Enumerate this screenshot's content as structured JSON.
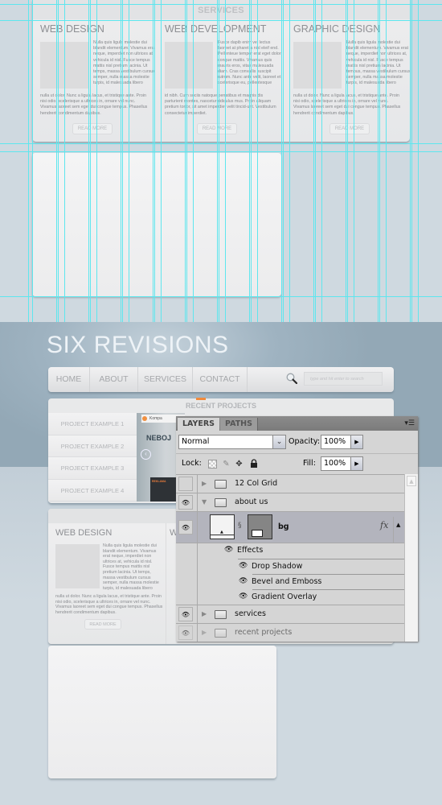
{
  "top_section": {
    "services_header": "SERVICES",
    "columns": [
      {
        "title": "WEB DESIGN",
        "side_text": "Nulla quis ligula molestie dui blandit elementum. Vivamus erat neque, imperdiet non ultrices at, vehicula id nisl. Fusce tempus mattis nisl pretium lacinia. Ut temps, massa vestibulum cursus semper, nulla massa molestie turpis, id malesuada libero",
        "full_text": "nulla ut dolor. Nunc a ligula lacus, et tristique ante. Proin nisi odio, scelerisque a ultrices in, ornare vel nunc. Vivamus laoreet sem eget dui congue tempus. Phasellus hendrerit condimentum dapibus.",
        "button": "READ MORE"
      },
      {
        "title": "WEB DEVELOPMENT",
        "side_text": "Fusce dapib enim vel lectus laoreet at pharetra nisl eleif end. Pellenteue tempor erat eget dolor congue mattis. Vivamus quis mauris eros, vitae malesuada diam. Cras convallis suscipit rutrum. Nunc ante velit, laoreet et scelerisque eu, pellentesque",
        "full_text": "id nibh. Cum sociis natoque penatibus et magnis dis parturient montes, nascetur ridiculus mus. Proin aliquam pretium tortor, sit amet imperdiet velit tincid-unt. Vestibulum consectetur imperdiet.",
        "button": "READ MORE"
      },
      {
        "title": "GRAPHIC DESIGN",
        "side_text": "Nulla quis ligula molestie dui blandit elementum. Vivamus erat neque, imperdiet non ultrices at, vehicula id nisl. Fusce tempus mattis nisl pretium lacinia. Ut tempus, massa vestibulum cursus semper, nulla massa molestie turpis, id malesuada libero",
        "full_text": "nulla ut dolor. Nunc a ligula lacus, et tristique ante. Proin nisi odio, scelerisque a ultrices in, ornare vel nunc. Vivamus laoreet sem eget dui congue tempus. Phasellus hendrerit condimentum dapibus.",
        "button": "READ MORE"
      }
    ]
  },
  "site": {
    "logo": "SIX REVISIONS",
    "nav": [
      "HOME",
      "ABOUT",
      "SERVICES",
      "CONTACT"
    ],
    "search_placeholder": "type and hit enter to search",
    "recent_projects_header": "RECENT PROJECTS",
    "projects": [
      "PROJECT EXAMPLE 1",
      "PROJECT EXAMPLE 2",
      "PROJECT EXAMPLE 3",
      "PROJECT EXAMPLE 4"
    ],
    "preview": {
      "brand": "Kompa",
      "headline": "NEBOJ",
      "badge": "REKLAMA"
    },
    "about_column": {
      "title": "WEB DESIGN",
      "side_text": "Nulla quis ligula molestie dui blandit elementum. Vivamus erat neque, imperdiet non ultrices at, vehicula id nisl. Fusce tempus mattis nisl pretium lacinia. Ut temps, massa vestibulum cursus semper, nulla massa molestie turpis, id malesuada libero",
      "full_text": "nulla ut dolor. Nunc a ligula lacus, et tristique ante. Proin nisi odio, scelerisque a ultrices in, ornare vel nunc. Vivamus laoreet sem eget dui congue tempus. Phasellus hendrerit condimentum dapibus.",
      "button": "READ MORE",
      "second_title_partial": "W",
      "ghost_button": "READ MORE"
    }
  },
  "layers_panel": {
    "tabs": [
      "LAYERS",
      "PATHS"
    ],
    "active_tab": "LAYERS",
    "blend_mode": "Normal",
    "opacity_label": "Opacity:",
    "opacity": "100%",
    "lock_label": "Lock:",
    "fill_label": "Fill:",
    "fill": "100%",
    "layers": [
      {
        "name": "12 Col Grid",
        "type": "group",
        "visible": false,
        "expanded": false
      },
      {
        "name": "about us",
        "type": "group",
        "visible": true,
        "expanded": true
      },
      {
        "name": "bg",
        "type": "layer",
        "visible": true,
        "selected": true,
        "fx": "fx"
      },
      {
        "name": "Effects",
        "type": "effects-header",
        "visible": true
      },
      {
        "name": "Drop Shadow",
        "type": "effect",
        "visible": true
      },
      {
        "name": "Bevel and Emboss",
        "type": "effect",
        "visible": true
      },
      {
        "name": "Gradient Overlay",
        "type": "effect",
        "visible": true
      },
      {
        "name": "services",
        "type": "group",
        "visible": true,
        "expanded": false
      },
      {
        "name": "recent projects",
        "type": "group",
        "visible": true,
        "expanded": false
      }
    ]
  },
  "colors": {
    "guide": "#5ee6ee",
    "background_top": "#cfd9e0",
    "header_blue": "#9fb3c1",
    "selected_layer": "#b3b4bd"
  }
}
